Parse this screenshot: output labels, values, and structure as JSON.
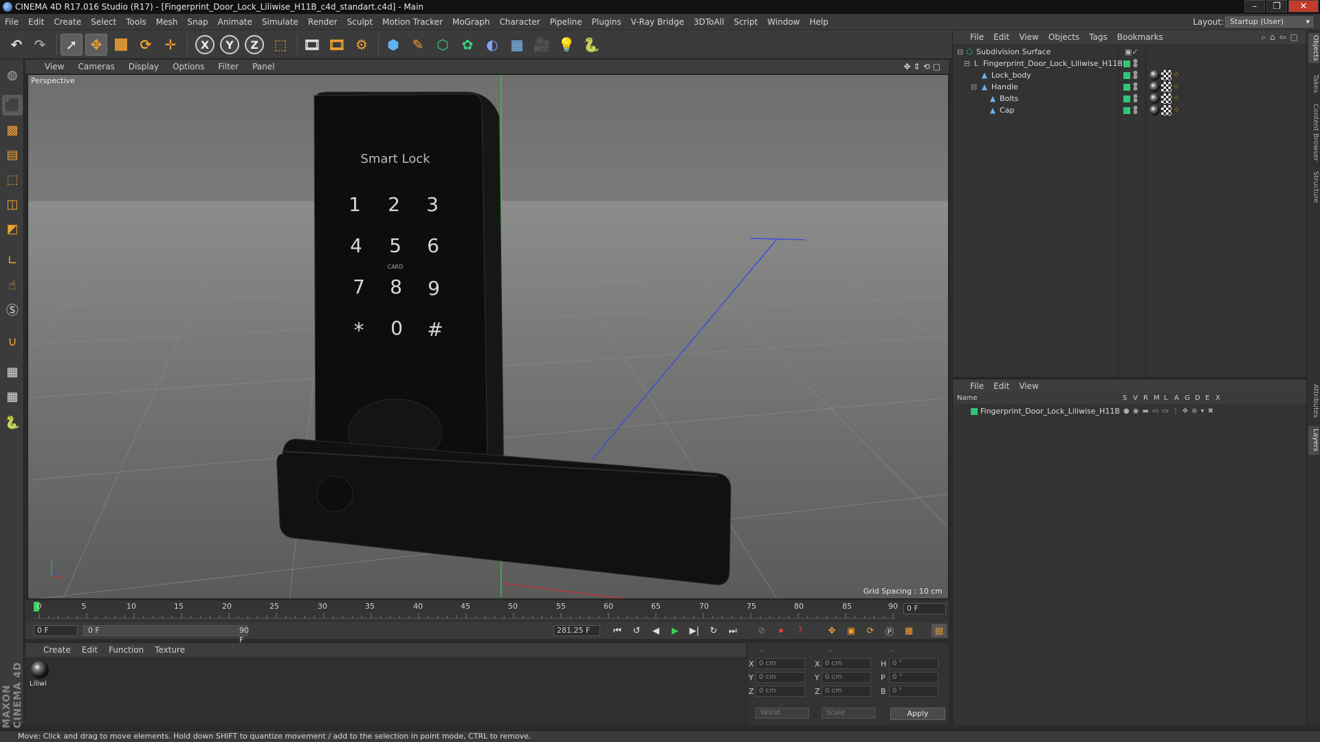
{
  "window": {
    "title": "CINEMA 4D R17.016 Studio (R17) - [Fingerprint_Door_Lock_Liliwise_H11B_c4d_standart.c4d] - Main",
    "controls": [
      "–",
      "❐",
      "✕"
    ]
  },
  "menubar": {
    "items": [
      "File",
      "Edit",
      "Create",
      "Select",
      "Tools",
      "Mesh",
      "Snap",
      "Animate",
      "Simulate",
      "Render",
      "Sculpt",
      "Motion Tracker",
      "MoGraph",
      "Character",
      "Pipeline",
      "Plugins",
      "V-Ray Bridge",
      "3DToAll",
      "Script",
      "Window",
      "Help"
    ],
    "layout_label": "Layout:",
    "layout_value": "Startup (User)"
  },
  "toolbar": {
    "icons": [
      "undo-icon",
      "redo-icon",
      "live-selection-icon",
      "move-icon",
      "scale-icon",
      "rotate-icon",
      "move-axis-icon",
      "x-axis-icon",
      "y-axis-icon",
      "z-axis-icon",
      "coordinate-system-icon",
      "render-view-icon",
      "render-picture-viewer-icon",
      "render-settings-icon",
      "cube-icon",
      "spline-pen-icon",
      "subdivision-icon",
      "mograph-cloner-icon",
      "deformer-icon",
      "floor-icon",
      "camera-icon",
      "light-icon",
      "python-icon"
    ],
    "axis_labels": [
      "X",
      "Y",
      "Z"
    ]
  },
  "left_toolbar": {
    "icons": [
      "make-editable-icon",
      "model-mode-icon",
      "texture-mode-icon",
      "workplane-mode-icon",
      "points-mode-icon",
      "edges-mode-icon",
      "polygons-mode-icon",
      "axis-mode-icon",
      "tweak-mode-icon",
      "solo-icon",
      "magnet-icon",
      "snap-grid-icon",
      "snap-settings-icon",
      "python-script-icon"
    ],
    "logo_text": "MAXON CINEMA 4D"
  },
  "viewport": {
    "menu": [
      "View",
      "Cameras",
      "Display",
      "Options",
      "Filter",
      "Panel"
    ],
    "label": "Perspective",
    "grid_spacing": "Grid Spacing : 10 cm",
    "nav_icons": [
      "✥",
      "⇕",
      "⟲",
      "▢"
    ],
    "model_text": {
      "brand": "Smart Lock",
      "keys": [
        "1",
        "2",
        "3",
        "4",
        "5",
        "6",
        "7",
        "8",
        "9",
        "*",
        "0",
        "#"
      ],
      "key_sub": "CARD"
    }
  },
  "timeline": {
    "ticks": [
      "0",
      "5",
      "10",
      "15",
      "20",
      "25",
      "30",
      "35",
      "40",
      "45",
      "50",
      "55",
      "60",
      "65",
      "70",
      "75",
      "80",
      "85",
      "90"
    ],
    "end_frame": "0 F"
  },
  "transport": {
    "current_frame": "0 F",
    "range_start": "0 F",
    "range_end": "90 F",
    "fps_field": "281.25 F",
    "buttons": [
      "⏮",
      "↺",
      "◀",
      "▶",
      "▶|",
      "↻",
      "⏭"
    ]
  },
  "material_panel": {
    "menu": [
      "Create",
      "Edit",
      "Function",
      "Texture"
    ],
    "material_name": "Liliwi"
  },
  "coords_panel": {
    "rows": [
      {
        "l1": "X",
        "v1": "0 cm",
        "l2": "X",
        "v2": "0 cm",
        "l3": "H",
        "v3": "0 °"
      },
      {
        "l1": "Y",
        "v1": "0 cm",
        "l2": "Y",
        "v2": "0 cm",
        "l3": "P",
        "v3": "0 °"
      },
      {
        "l1": "Z",
        "v1": "0 cm",
        "l2": "Z",
        "v2": "0 cm",
        "l3": "B",
        "v3": "0 °"
      }
    ],
    "header_marks": [
      "--",
      "--",
      "--"
    ],
    "world": "World",
    "scale": "Scale",
    "apply": "Apply"
  },
  "objects_panel": {
    "menu": [
      "File",
      "Edit",
      "View",
      "Objects",
      "Tags",
      "Bookmarks"
    ],
    "tree": [
      {
        "label": "Subdivision Surface",
        "icon": "subdivision-icon"
      },
      {
        "label": "Fingerprint_Door_Lock_Liliwise_H11B",
        "icon": "layer-null-icon"
      },
      {
        "label": "Lock_body",
        "icon": "polygon-object-icon"
      },
      {
        "label": "Handle",
        "icon": "polygon-object-icon"
      },
      {
        "label": "Bolts",
        "icon": "polygon-object-icon"
      },
      {
        "label": "Cap",
        "icon": "polygon-object-icon"
      }
    ]
  },
  "layers_panel": {
    "menu": [
      "File",
      "Edit",
      "View"
    ],
    "columns": [
      "Name",
      "S",
      "V",
      "R",
      "M",
      "L",
      "A",
      "G",
      "D",
      "E",
      "X"
    ],
    "rows": [
      {
        "label": "Fingerprint_Door_Lock_Liliwise_H11B",
        "color": "#2fc77b"
      }
    ]
  },
  "right_tabs": [
    "Objects",
    "Takes",
    "Content Browser",
    "Structure",
    "Attributes",
    "Layers"
  ],
  "status": {
    "text": "Move: Click and drag to move elements. Hold down SHIFT to quantize movement / add to the selection in point mode, CTRL to remove."
  },
  "colors": {
    "accent_orange": "#f0a030",
    "tag_green": "#2fc77b",
    "axis_blue": "#3b4fd8",
    "axis_green": "#2fc62f"
  }
}
